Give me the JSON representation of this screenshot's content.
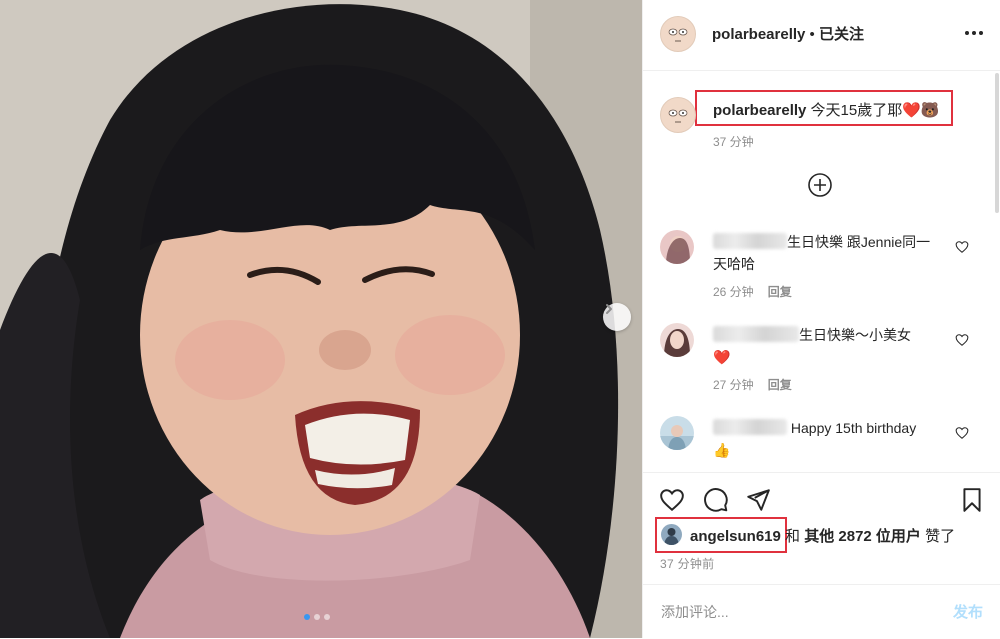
{
  "post": {
    "carousel": {
      "total_slides": 3,
      "active_slide": 1
    }
  },
  "header": {
    "username": "polarbearelly",
    "separator": " • ",
    "follow_status": "已关注",
    "more_icon": "more-horizontal-icon"
  },
  "caption": {
    "username": "polarbearelly",
    "text": " 今天15歲了耶",
    "emoji": "❤️🐻",
    "time": "37 分钟"
  },
  "load_more_icon": "plus-circle-icon",
  "comments": [
    {
      "text": "生日快樂 跟Jennie同一天哈哈",
      "time": "26 分钟",
      "reply": "回复"
    },
    {
      "text": "生日快樂～小美女",
      "emoji": "❤️",
      "time": "27 分钟",
      "reply": "回复"
    },
    {
      "text": "Happy 15th birthday",
      "emoji": "👍"
    }
  ],
  "actions": {
    "icons": [
      "heart-icon",
      "comment-icon",
      "share-icon",
      "bookmark-icon"
    ],
    "liked_by": "angelsun619",
    "and": " 和 ",
    "others_count_text": "其他 2872 位用户",
    "liked_suffix": " 赞了",
    "posted_time": "37 分钟前"
  },
  "add_comment": {
    "placeholder": "添加评论...",
    "post_label": "发布"
  },
  "colors": {
    "highlight_box": "#e0313e",
    "link_blue": "#3897f0",
    "post_disabled": "#b2dffc"
  }
}
